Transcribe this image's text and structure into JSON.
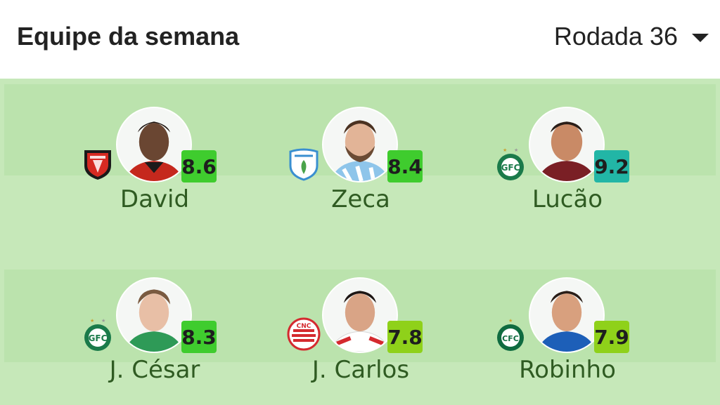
{
  "header": {
    "title": "Equipe da semana",
    "round_label": "Rodada 36"
  },
  "colors": {
    "pitch_light": "#c6e8b9",
    "pitch_band": "#bbe3ad",
    "name_color": "#2f5b22",
    "rating_green": "#3fcc2e",
    "rating_teal": "#22b6a6",
    "rating_lime": "#8fd11a"
  },
  "players": [
    {
      "name": "David",
      "rating": "8.6",
      "team_badge": "vitoria-badge-icon",
      "rating_color": "#3fcc2e"
    },
    {
      "name": "Zeca",
      "rating": "8.4",
      "team_badge": "londrina-badge-icon",
      "rating_color": "#3fcc2e"
    },
    {
      "name": "Lucão",
      "rating": "9.2",
      "team_badge": "guarani-badge-icon",
      "rating_color": "#22b6a6"
    },
    {
      "name": "J. César",
      "rating": "8.3",
      "team_badge": "guarani-badge-icon",
      "rating_color": "#3fcc2e"
    },
    {
      "name": "J. Carlos",
      "rating": "7.8",
      "team_badge": "nautico-badge-icon",
      "rating_color": "#8fd11a"
    },
    {
      "name": "Robinho",
      "rating": "7.9",
      "team_badge": "coritiba-badge-icon",
      "rating_color": "#8fd11a"
    }
  ]
}
